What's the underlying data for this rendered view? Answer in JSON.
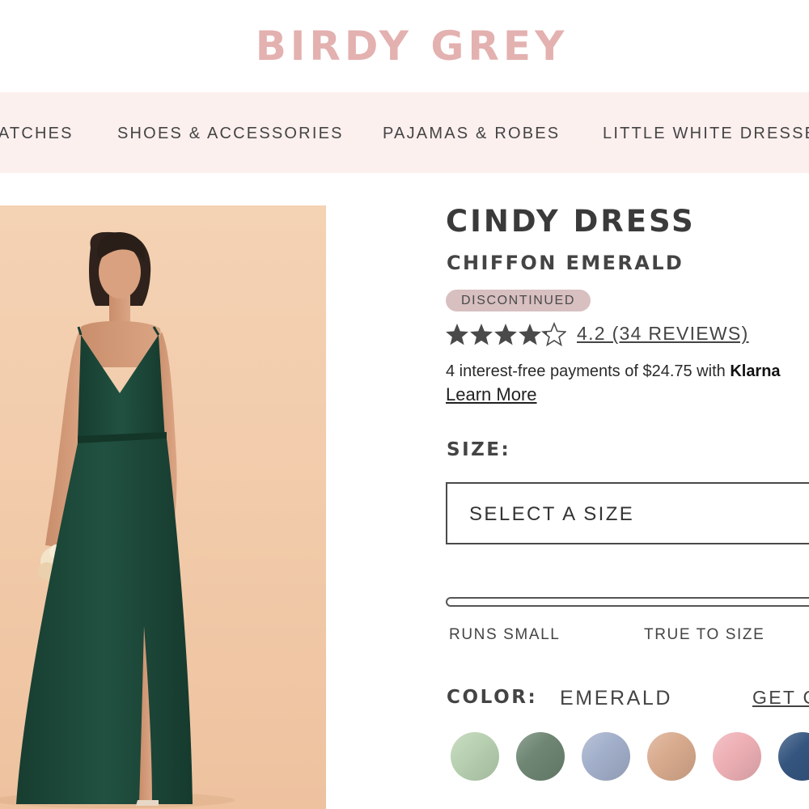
{
  "brand": {
    "logo_text": "BIRDY GREY",
    "logo_color": "#e3b1b0"
  },
  "nav": {
    "items": [
      {
        "label": "SWATCHES"
      },
      {
        "label": "SHOES & ACCESSORIES"
      },
      {
        "label": "PAJAMAS & ROBES"
      },
      {
        "label": "LITTLE WHITE DRESSES"
      }
    ]
  },
  "product": {
    "title": "CINDY DRESS",
    "subtitle": "CHIFFON EMERALD",
    "badge": "DISCONTINUED",
    "rating": {
      "value": 4.2,
      "max": 5,
      "text": "4.2 (34 REVIEWS)"
    },
    "payments": {
      "text": "4 interest-free payments of $24.75 with ",
      "provider": "Klarna",
      "learn_more": "Learn More"
    },
    "size": {
      "label": "SIZE:",
      "placeholder": "SELECT A SIZE"
    },
    "fit": {
      "left_label": "RUNS SMALL",
      "center_label": "TRUE TO SIZE"
    },
    "color": {
      "label": "COLOR:",
      "value": "EMERALD",
      "link_text": "GET COLOR SWATCHES",
      "swatches": [
        {
          "name": "sage",
          "color": "#b8d1b1"
        },
        {
          "name": "dark-sage",
          "color": "#6e8673"
        },
        {
          "name": "dusty-blue",
          "color": "#a3b0cb"
        },
        {
          "name": "taupe",
          "color": "#d9ab8e"
        },
        {
          "name": "blush",
          "color": "#eeb0b5"
        },
        {
          "name": "navy-blue",
          "color": "#34557f"
        }
      ]
    },
    "dress_color": "#1f4a3a",
    "backdrop_color": "#f2cdae"
  }
}
